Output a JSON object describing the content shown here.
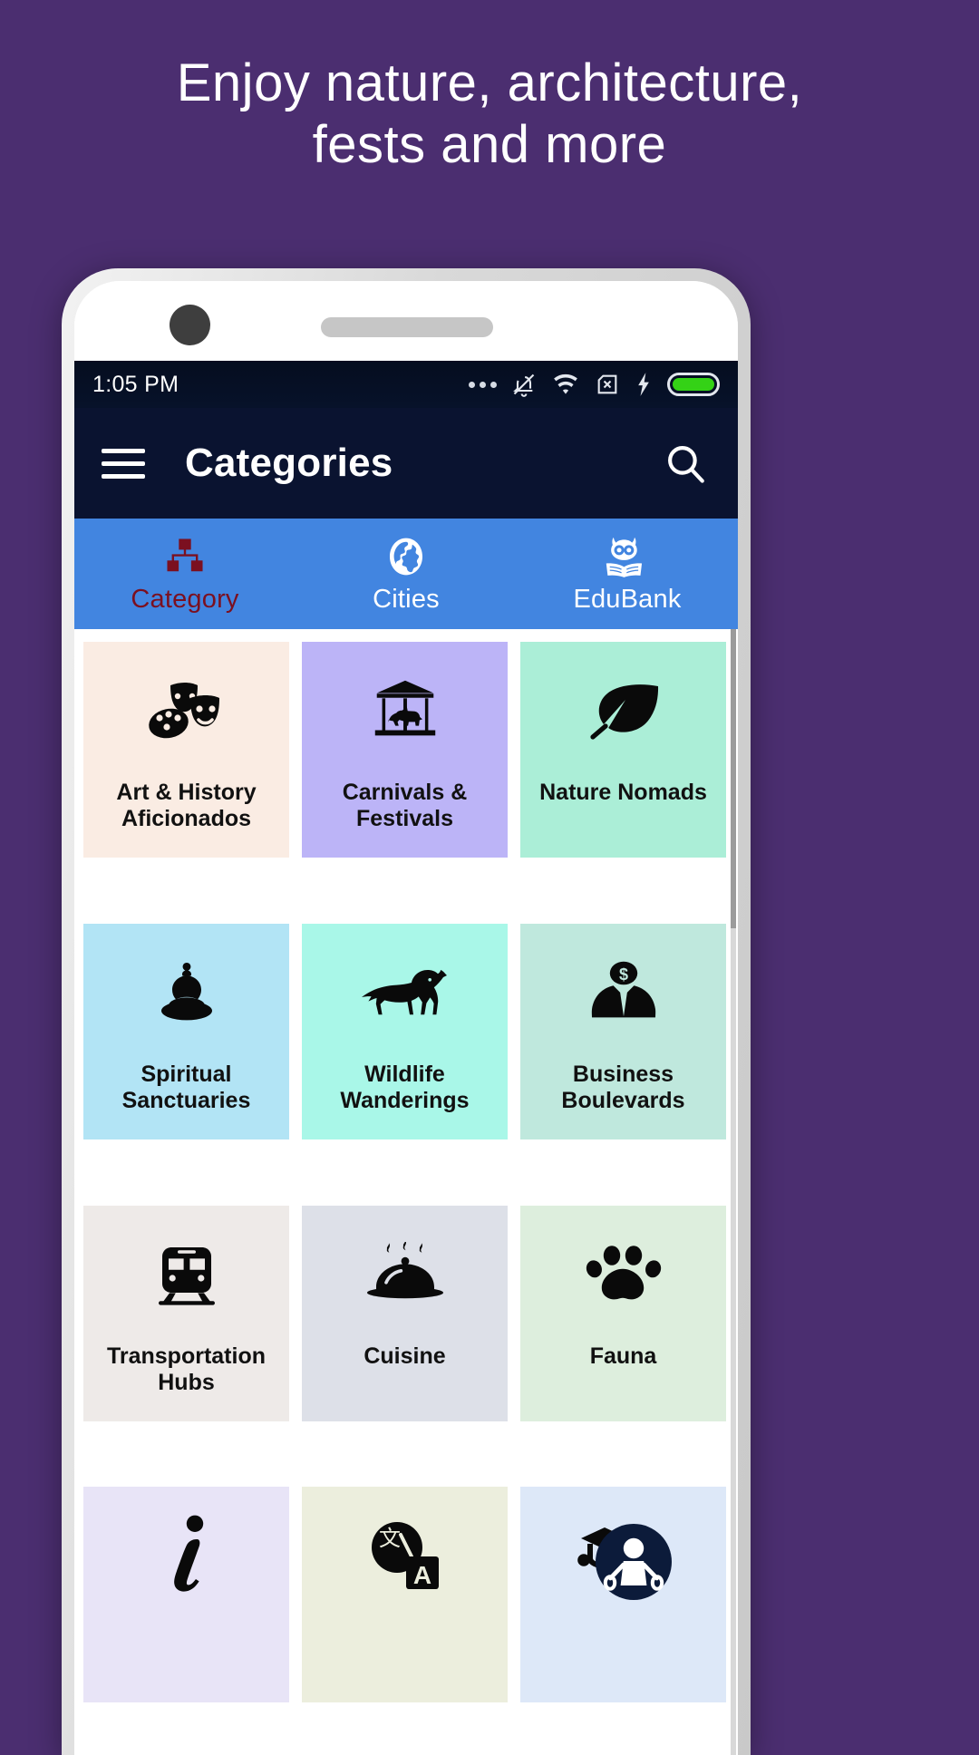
{
  "promo": {
    "line1": "Enjoy nature, architecture,",
    "line2": "fests and more",
    "background_color": "#4b2e70",
    "text_color": "#ffffff"
  },
  "status_bar": {
    "time": "1:05 PM",
    "icons": [
      "more-dots",
      "bell-muted",
      "wifi",
      "sim-x",
      "charging-bolt",
      "battery-full"
    ],
    "battery_color": "#34d216",
    "background_color": "#07122a"
  },
  "app_bar": {
    "menu_icon": "hamburger-menu-icon",
    "title": "Categories",
    "search_icon": "search-icon",
    "background_color": "#0a1330"
  },
  "tabs": {
    "background_color": "#4285e0",
    "active_label_color": "#7b1020",
    "items": [
      {
        "label": "Category",
        "icon": "sitemap-icon",
        "active": true
      },
      {
        "label": "Cities",
        "icon": "globe-icon",
        "active": false
      },
      {
        "label": "EduBank",
        "icon": "owl-book-icon",
        "active": false
      }
    ]
  },
  "categories": [
    {
      "label": "Art & History Aficionados",
      "icon": "masks-palette-icon",
      "bg": "#faece3"
    },
    {
      "label": "Carnivals & Festivals",
      "icon": "carousel-icon",
      "bg": "#bcb4f7"
    },
    {
      "label": "Nature Nomads",
      "icon": "leaf-icon",
      "bg": "#abeed7"
    },
    {
      "label": "Spiritual Sanctuaries",
      "icon": "buddha-icon",
      "bg": "#b2e4f5"
    },
    {
      "label": "Wildlife Wanderings",
      "icon": "lion-icon",
      "bg": "#a9f7e8"
    },
    {
      "label": "Business Boulevards",
      "icon": "businessman-dollar-icon",
      "bg": "#bfe8dd"
    },
    {
      "label": "Transportation Hubs",
      "icon": "train-icon",
      "bg": "#eeeae8"
    },
    {
      "label": "Cuisine",
      "icon": "food-cloche-icon",
      "bg": "#dde0e8"
    },
    {
      "label": "Fauna",
      "icon": "paw-print-icon",
      "bg": "#ddeedd"
    },
    {
      "label": "",
      "icon": "info-italic-icon",
      "bg": "#e8e4f7"
    },
    {
      "label": "",
      "icon": "translate-icon",
      "bg": "#eceedd"
    },
    {
      "label": "",
      "icon": "graduate-badge-icon",
      "bg": "#dde8f8"
    }
  ]
}
